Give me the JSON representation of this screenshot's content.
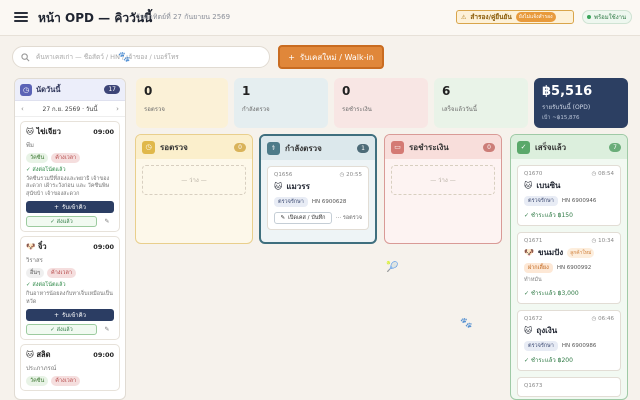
{
  "header": {
    "title": "หน้า OPD — คิววันนี้",
    "date": "วันอาทิตย์ที่ 27 กันยายน 2569",
    "partner_label": "สำรอง/คู่ยืนยัน",
    "partner_pill": "ยังไม่แจ้งสำรอง",
    "ready_label": "พร้อมใช้งาน"
  },
  "search": {
    "placeholder": "ค้นหาเคสเก่า — ชื่อสัตว์ / HN / เจ้าของ / เบอร์โทร"
  },
  "walkin_button": {
    "label": "รับเคสใหม่ / Walk-in"
  },
  "appointments": {
    "title": "นัดวันนี้",
    "count": "17",
    "date_label": "27 ก.ย. 2569 · วันนี้",
    "items": [
      {
        "pet": "ไข่เจียว",
        "time": "09:00",
        "owner": "พีม",
        "tag1": "วัคซีน",
        "tag2": "ค้างเวลา",
        "confirm": "✓ ส่งต่อโน้ตแล้ว",
        "note": "วัคซีนรวมปีที่สองและพยาธิ เจ้าของสะดวก เฝ้าระวังก่อน และ วัคซีนพิษสุนัขบ้า เจ้าของสะดวก",
        "receive": "รับเข้าคิว",
        "sent": "ส่งแล้ว"
      },
      {
        "pet": "จิ๋ว",
        "time": "09:00",
        "owner": "วิราสร",
        "tag1": "อื่นๆ",
        "tag2": "ค้างเวลา",
        "confirm": "✓ ส่งต่อโน้ตแล้ว",
        "note": "กินอาหารน้อยลงกับทาเจ็บเหมือนเป็นหวัด",
        "receive": "รับเข้าคิว",
        "sent": "ส่งแล้ว"
      },
      {
        "pet": "สลิด",
        "time": "09:00",
        "owner": "ประภาภรณ์",
        "tag1": "วัคซีน",
        "tag2": "ค้างเวลา"
      }
    ]
  },
  "stats": {
    "waiting": {
      "value": "0",
      "label": "รอตรวจ"
    },
    "examining": {
      "value": "1",
      "label": "กำลังตรวจ"
    },
    "paying": {
      "value": "0",
      "label": "รอชำระเงิน"
    },
    "done": {
      "value": "6",
      "label": "เสร็จแล้ววันนี้"
    },
    "revenue": {
      "value": "฿5,516",
      "label": "รายรับวันนี้ (OPD)",
      "sub": "เป้า ~฿15,876"
    }
  },
  "columns": {
    "waiting": {
      "title": "รอตรวจ",
      "count": "0",
      "empty": "— ว่าง —"
    },
    "examining": {
      "title": "กำลังตรวจ",
      "count": "1",
      "card": {
        "queue": "Q1656",
        "time": "20:55",
        "pet": "แมวรร",
        "service": "ตรวจรักษา",
        "hn": "HN 6900628",
        "open": "เปิดเคส / บันทึก",
        "more": "··· รอตรวจ"
      }
    },
    "paying": {
      "title": "รอชำระเงิน",
      "count": "0",
      "empty": "— ว่าง —"
    },
    "done": {
      "title": "เสร็จแล้ว",
      "count": "7",
      "cards": [
        {
          "queue": "Q1670",
          "time": "08:54",
          "pet": "เบนซิน",
          "extra": "",
          "service": "ตรวจรักษา",
          "hn": "HN 6900946",
          "note": "",
          "paid": "✓ ชำระแล้ว ฿150"
        },
        {
          "queue": "Q1671",
          "time": "10:34",
          "pet": "ขนมปัง",
          "extra": "ลูกค้าใหม่",
          "service": "ฝากเลี้ยง",
          "hn": "HN 6900992",
          "note": "ทำหมัน",
          "paid": "✓ ชำระแล้ว ฿3,000"
        },
        {
          "queue": "Q1672",
          "time": "06:46",
          "pet": "ถุงเงิน",
          "extra": "",
          "service": "ตรวจรักษา",
          "hn": "HN 6900986",
          "note": "",
          "paid": "✓ ชำระแล้ว ฿200"
        },
        {
          "queue": "Q1673",
          "time": "",
          "pet": "",
          "extra": "",
          "service": "",
          "hn": "",
          "note": "",
          "paid": ""
        }
      ]
    }
  },
  "icons": {
    "menu": "hamburger-icon",
    "search": "search-icon",
    "add": "plus-icon",
    "calendar": "calendar-icon"
  },
  "colors": {
    "primary": "#2c3f62",
    "accent": "#e0873a",
    "waiting": "#e0b84a",
    "examining": "#4d7b89",
    "paying": "#d47a74",
    "done": "#5aa86a"
  }
}
